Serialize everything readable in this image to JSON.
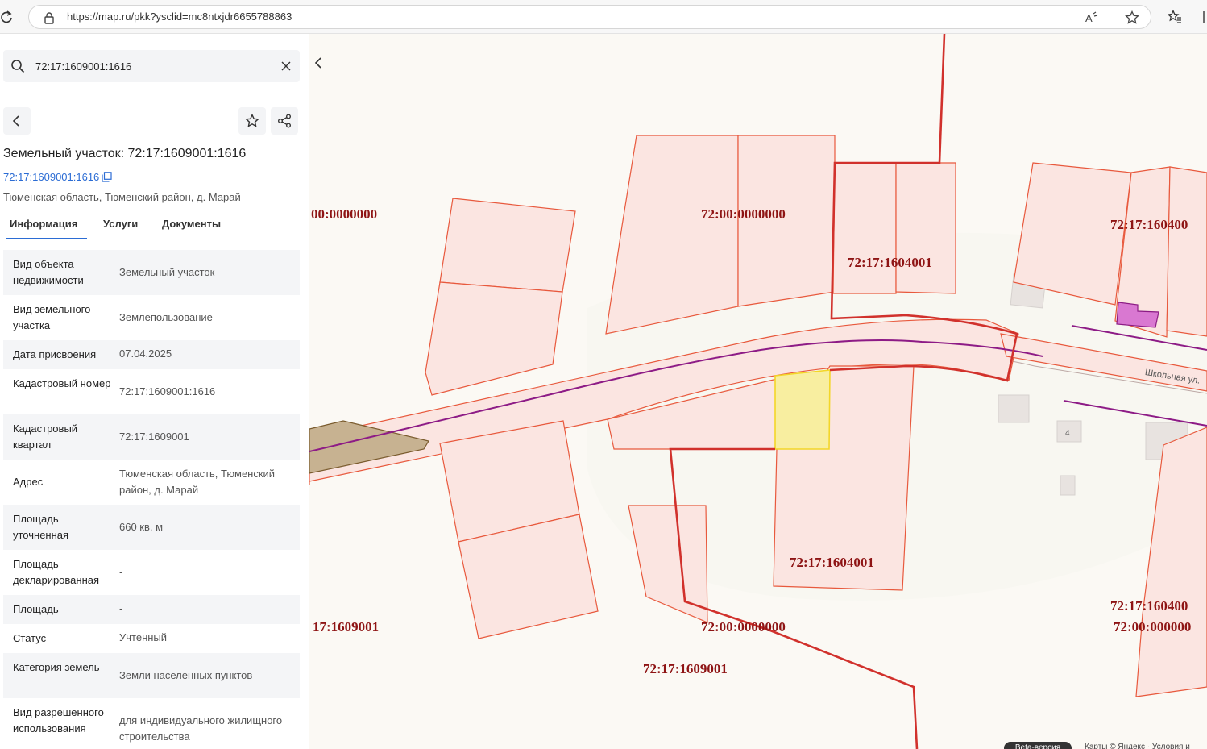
{
  "browser": {
    "url": "https://map.ru/pkk?ysclid=mc8ntxjdr6655788863"
  },
  "search": {
    "value": "72:17:1609001:1616"
  },
  "object": {
    "title": "Земельный участок: 72:17:1609001:1616",
    "cadastral_link": "72:17:1609001:1616",
    "address": "Тюменская область, Тюменский район, д. Марай"
  },
  "tabs": [
    {
      "label": "Информация",
      "active": true
    },
    {
      "label": "Услуги",
      "active": false
    },
    {
      "label": "Документы",
      "active": false
    }
  ],
  "info": [
    {
      "key": "Вид объекта недвижимости",
      "value": "Земельный участок"
    },
    {
      "key": "Вид земельного участка",
      "value": "Землепользование"
    },
    {
      "key": "Дата присвоения",
      "value": "07.04.2025"
    },
    {
      "key": "Кадастровый номер",
      "value": "72:17:1609001:1616"
    },
    {
      "key": "Кадастровый квартал",
      "value": "72:17:1609001"
    },
    {
      "key": "Адрес",
      "value": "Тюменская область, Тюменский район, д. Марай"
    },
    {
      "key": "Площадь уточненная",
      "value": "660 кв. м"
    },
    {
      "key": "Площадь декларированная",
      "value": "-"
    },
    {
      "key": "Площадь",
      "value": "-"
    },
    {
      "key": "Статус",
      "value": "Учтенный"
    },
    {
      "key": "Категория земель",
      "value": "Земли населенных пунктов"
    },
    {
      "key": "Вид разрешенного использования",
      "value": "для индивидуального жилищного строительства"
    }
  ],
  "map": {
    "labels": [
      "00:0000000",
      "72:00:0000000",
      "72:17:1604001",
      "72:17:160400",
      "72:17:1604001",
      "17:1609001",
      "72:00:0000000",
      "72:17:1609001",
      "72:17:160400",
      "72:00:000000"
    ],
    "street": "Школьная ул.",
    "house_number": "4",
    "beta": "Beta-версия",
    "copyright": "Карты © Яндекс · Условия и"
  },
  "colors": {
    "parcel_fill": "#fbe5e1",
    "parcel_stroke": "#e8593d",
    "quarter_border": "#d1312c",
    "selected_fill": "#f8eea0",
    "selected_stroke": "#f3d628",
    "road_line": "#8d1b86",
    "accent": "#2b6cd4"
  }
}
